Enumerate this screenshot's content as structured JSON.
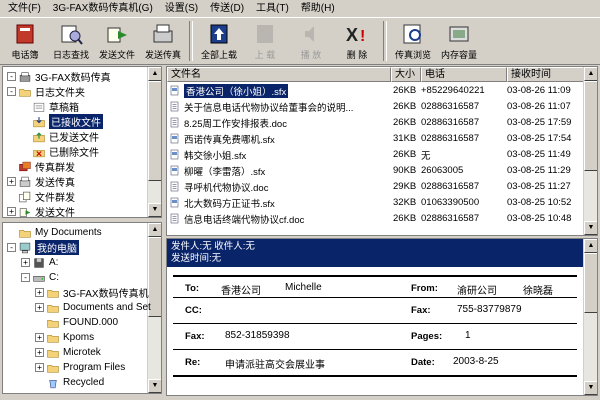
{
  "menu": [
    "文件(F)",
    "3G-FAX数码传真机(G)",
    "设置(S)",
    "传送(D)",
    "工具(T)",
    "帮助(H)"
  ],
  "toolbar": {
    "buttons": [
      {
        "label": "电话簿",
        "icon": "phonebook-icon",
        "disabled": false
      },
      {
        "label": "日志查找",
        "icon": "log-search-icon",
        "disabled": false
      },
      {
        "label": "发送文件",
        "icon": "send-file-icon",
        "disabled": false
      },
      {
        "label": "发送传真",
        "icon": "send-fax-icon",
        "disabled": false
      },
      {
        "label": "全部上载",
        "icon": "upload-all-icon",
        "disabled": false
      },
      {
        "label": "上 载",
        "icon": "upload-icon",
        "disabled": true
      },
      {
        "label": "播 放",
        "icon": "play-icon",
        "disabled": true
      },
      {
        "label": "删 除",
        "icon": "delete-icon",
        "disabled": false
      },
      {
        "label": "传真浏览",
        "icon": "fax-view-icon",
        "disabled": false
      },
      {
        "label": "内存容量",
        "icon": "memory-icon",
        "disabled": false
      }
    ]
  },
  "tree_top": {
    "items": [
      {
        "label": "3G-FAX数码传真",
        "level": 0,
        "exp": "-",
        "icon": "fax-machine-icon"
      },
      {
        "label": "日志文件夹",
        "level": 0,
        "exp": "-",
        "icon": "folder-icon"
      },
      {
        "label": "草稿箱",
        "level": 1,
        "exp": "",
        "icon": "drafts-icon"
      },
      {
        "label": "已接收文件",
        "level": 1,
        "exp": "",
        "icon": "received-icon",
        "selected": true
      },
      {
        "label": "已发送文件",
        "level": 1,
        "exp": "",
        "icon": "sent-icon"
      },
      {
        "label": "已删除文件",
        "level": 1,
        "exp": "",
        "icon": "deleted-icon"
      },
      {
        "label": "传真群发",
        "level": 0,
        "exp": "",
        "icon": "group-fax-icon"
      },
      {
        "label": "发送传真",
        "level": 0,
        "exp": "+",
        "icon": "send-fax-icon"
      },
      {
        "label": "文件群发",
        "level": 0,
        "exp": "",
        "icon": "group-file-icon"
      },
      {
        "label": "发送文件",
        "level": 0,
        "exp": "+",
        "icon": "send-file-icon"
      }
    ]
  },
  "tree_bottom": {
    "items": [
      {
        "label": "My Documents",
        "level": 0,
        "exp": "",
        "icon": "folder-icon"
      },
      {
        "label": "我的电脑",
        "level": 0,
        "exp": "-",
        "icon": "computer-icon",
        "selected": true
      },
      {
        "label": "A:",
        "level": 1,
        "exp": "+",
        "icon": "floppy-icon"
      },
      {
        "label": "C:",
        "level": 1,
        "exp": "-",
        "icon": "drive-icon"
      },
      {
        "label": "3G-FAX数码传真机",
        "level": 2,
        "exp": "+",
        "icon": "folder-icon"
      },
      {
        "label": "Documents and Set",
        "level": 2,
        "exp": "+",
        "icon": "folder-icon"
      },
      {
        "label": "FOUND.000",
        "level": 2,
        "exp": "",
        "icon": "folder-icon"
      },
      {
        "label": "Kpoms",
        "level": 2,
        "exp": "+",
        "icon": "folder-icon"
      },
      {
        "label": "Microtek",
        "level": 2,
        "exp": "+",
        "icon": "folder-icon"
      },
      {
        "label": "Program Files",
        "level": 2,
        "exp": "+",
        "icon": "folder-icon"
      },
      {
        "label": "Recycled",
        "level": 2,
        "exp": "",
        "icon": "recycle-icon"
      }
    ]
  },
  "filelist": {
    "columns": [
      "文件名",
      "大小",
      "电话",
      "接收时间"
    ],
    "rows": [
      {
        "name": "香港公司（徐小姐）.sfx",
        "size": "26KB",
        "phone": "+85229640221",
        "time": "03-08-26 11:09",
        "icon": "fax-file-icon",
        "selected": true
      },
      {
        "name": "关于信息电话代物协议给董事会的说明...",
        "size": "26KB",
        "phone": "02886316587",
        "time": "03-08-26 11:07",
        "icon": "doc-file-icon"
      },
      {
        "name": "8.25周工作安排报表.doc",
        "size": "26KB",
        "phone": "02886316587",
        "time": "03-08-25 17:59",
        "icon": "doc-file-icon"
      },
      {
        "name": "西诺传真免费哪机.sfx",
        "size": "31KB",
        "phone": "02886316587",
        "time": "03-08-25 17:54",
        "icon": "fax-file-icon"
      },
      {
        "name": "韩交徐小姐.sfx",
        "size": "26KB",
        "phone": "无",
        "time": "03-08-25 11:49",
        "icon": "fax-file-icon"
      },
      {
        "name": "柳曜（李雷落）.sfx",
        "size": "90KB",
        "phone": "26063005",
        "time": "03-08-25 11:29",
        "icon": "fax-file-icon"
      },
      {
        "name": "寻呼机代物协议.doc",
        "size": "29KB",
        "phone": "02886316587",
        "time": "03-08-25 11:27",
        "icon": "doc-file-icon"
      },
      {
        "name": "北大数码方正证书.sfx",
        "size": "32KB",
        "phone": "01063390500",
        "time": "03-08-25 10:52",
        "icon": "fax-file-icon"
      },
      {
        "name": "信息电话终端代物协议cf.doc",
        "size": "26KB",
        "phone": "02886316587",
        "time": "03-08-25 10:48",
        "icon": "doc-file-icon"
      }
    ]
  },
  "preview": {
    "header_line1": "发件人:无    收件人:无",
    "header_line2": "发送时间:无",
    "fax": {
      "to_label": "To:",
      "to_company": "香港公司",
      "to_person": "Michelle",
      "from_label": "From:",
      "from_company": "渝研公司",
      "from_person": "徐晓磊",
      "cc_label": "CC:",
      "fax_label": "Fax:",
      "fax_value": "755-83779879",
      "fax2_label": "Fax:",
      "fax2_value": "852-31859398",
      "pages_label": "Pages:",
      "pages_value": "1",
      "re_label": "Re:",
      "re_value": "申请派驻高交会展业事",
      "date_label": "Date:",
      "date_value": "2003-8-25"
    }
  }
}
